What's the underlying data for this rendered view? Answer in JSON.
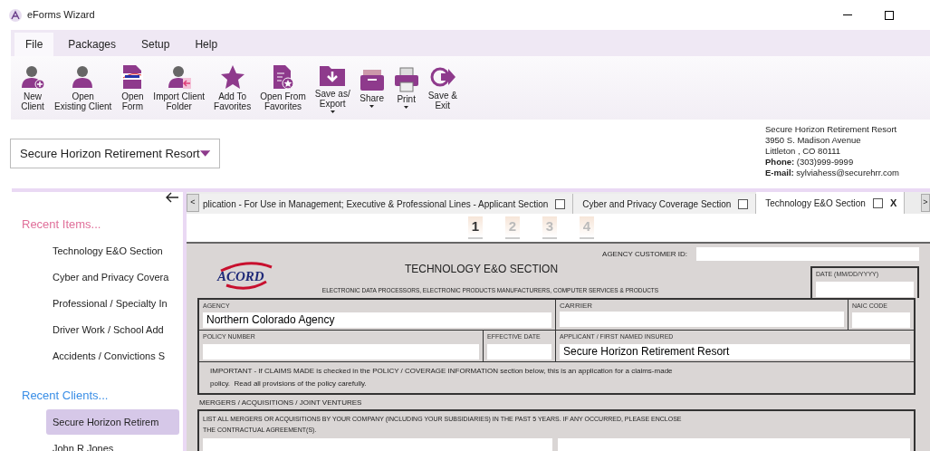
{
  "window": {
    "title": "eForms Wizard"
  },
  "menu": [
    {
      "label": "File",
      "selected": true
    },
    {
      "label": "Packages",
      "selected": false
    },
    {
      "label": "Setup",
      "selected": false
    },
    {
      "label": "Help",
      "selected": false
    }
  ],
  "toolbar": [
    {
      "kind": "new-client",
      "label": "New\nClient",
      "dropdown": false
    },
    {
      "kind": "open-client",
      "label": "Open\nExisting Client",
      "dropdown": false
    },
    {
      "kind": "open-form",
      "label": "Open\nForm",
      "dropdown": false
    },
    {
      "kind": "import",
      "label": "Import Client\nFolder",
      "dropdown": false
    },
    {
      "kind": "star",
      "label": "Add To\nFavorites",
      "dropdown": false
    },
    {
      "kind": "open-favorites",
      "label": "Open From\nFavorites",
      "dropdown": false
    },
    {
      "kind": "save-export",
      "label": "Save as/\nExport",
      "dropdown": true
    },
    {
      "kind": "share",
      "label": "Share",
      "dropdown": true
    },
    {
      "kind": "print",
      "label": "Print",
      "dropdown": true
    },
    {
      "kind": "exit",
      "label": "Save &\nExit",
      "dropdown": false
    }
  ],
  "client_select": {
    "value": "Secure Horizon Retirement Resort"
  },
  "contact": {
    "name": "Secure Horizon Retirement Resort",
    "street": "3950 S. Madison Avenue",
    "city": "Littleton , CO 80111",
    "phone_label": "Phone:",
    "phone": "(303)999-9999",
    "email_label": "E-mail:",
    "email": "sylviahess@securehrr.com"
  },
  "sidebar": {
    "sections": [
      {
        "title": "Recent Items...",
        "color": "#e0709a",
        "items": [
          {
            "label": "Technology E&O Section",
            "selected": false
          },
          {
            "label": "Cyber and Privacy Covera",
            "selected": false
          },
          {
            "label": "Professional / Specialty In",
            "selected": false
          },
          {
            "label": "Driver Work / School Add",
            "selected": false
          },
          {
            "label": "Accidents / Convictions S",
            "selected": false
          }
        ]
      },
      {
        "title": "Recent Clients...",
        "color": "#3a8ee6",
        "items": [
          {
            "label": "Secure Horizon Retirem",
            "selected": true
          },
          {
            "label": "John R Jones",
            "selected": false
          }
        ]
      }
    ]
  },
  "tabs": [
    {
      "label": "plication - For Use in Management; Executive & Professional Lines - Applicant Section",
      "checked": false,
      "selected": false,
      "closable": false
    },
    {
      "label": "Cyber and Privacy Coverage Section",
      "checked": false,
      "selected": false,
      "closable": false
    },
    {
      "label": "Technology E&O Section",
      "checked": false,
      "selected": true,
      "closable": true
    }
  ],
  "tab_scroll": {
    "left": "<",
    "right": ">",
    "close": "X"
  },
  "pages": [
    {
      "label": "1",
      "selected": true
    },
    {
      "label": "2",
      "selected": false
    },
    {
      "label": "3",
      "selected": false
    },
    {
      "label": "4",
      "selected": false
    }
  ],
  "form": {
    "logo": "ACORD",
    "title": "TECHNOLOGY E&O SECTION",
    "subtitle": "ELECTRONIC DATA PROCESSORS, ELECTRONIC PRODUCTS MANUFACTURERS, COMPUTER SERVICES & PRODUCTS",
    "customer_id_label": "AGENCY CUSTOMER ID:",
    "date_label": "DATE (MM/DD/YYYY)",
    "agency_label": "AGENCY",
    "agency": "Northern Colorado Agency",
    "carrier_label": "CARRIER",
    "naic_label": "NAIC CODE",
    "policy_label": "POLICY NUMBER",
    "effective_label": "EFFECTIVE DATE",
    "applicant_label": "APPLICANT / FIRST NAMED INSURED",
    "applicant": "Secure Horizon Retirement Resort",
    "important": "IMPORTANT - If CLAIMS MADE is checked in the POLICY / COVERAGE INFORMATION section below, this is an application for a claims-made\npolicy.  Read all provisions of the policy carefully.",
    "mergers_heading": "MERGERS / ACQUISITIONS / JOINT VENTURES",
    "mergers_text": "LIST ALL MERGERS OR ACQUISITIONS BY YOUR COMPANY (INCLUDING YOUR SUBSIDIARIES) IN THE PAST 5 YEARS. IF ANY OCCURRED, PLEASE ENCLOSE\nTHE CONTRACTUAL AGREEMENT(S)."
  }
}
